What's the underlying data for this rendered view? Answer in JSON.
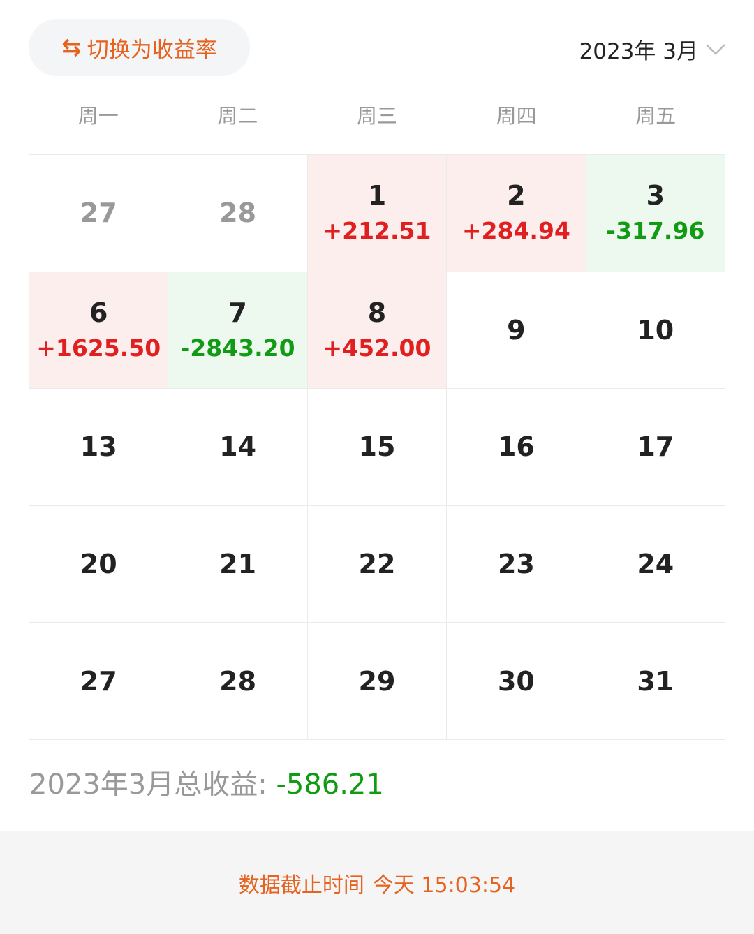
{
  "header": {
    "toggle_label": "切换为收益率",
    "month_label": "2023年 3月"
  },
  "weekdays": [
    "周一",
    "周二",
    "周三",
    "周四",
    "周五"
  ],
  "days": [
    {
      "day": "27",
      "value": "",
      "state": "other"
    },
    {
      "day": "28",
      "value": "",
      "state": "other"
    },
    {
      "day": "1",
      "value": "+212.51",
      "state": "up"
    },
    {
      "day": "2",
      "value": "+284.94",
      "state": "up"
    },
    {
      "day": "3",
      "value": "-317.96",
      "state": "down"
    },
    {
      "day": "6",
      "value": "+1625.50",
      "state": "up"
    },
    {
      "day": "7",
      "value": "-2843.20",
      "state": "down"
    },
    {
      "day": "8",
      "value": "+452.00",
      "state": "up"
    },
    {
      "day": "9",
      "value": "",
      "state": "none"
    },
    {
      "day": "10",
      "value": "",
      "state": "none"
    },
    {
      "day": "13",
      "value": "",
      "state": "none"
    },
    {
      "day": "14",
      "value": "",
      "state": "none"
    },
    {
      "day": "15",
      "value": "",
      "state": "none"
    },
    {
      "day": "16",
      "value": "",
      "state": "none"
    },
    {
      "day": "17",
      "value": "",
      "state": "none"
    },
    {
      "day": "20",
      "value": "",
      "state": "none"
    },
    {
      "day": "21",
      "value": "",
      "state": "none"
    },
    {
      "day": "22",
      "value": "",
      "state": "none"
    },
    {
      "day": "23",
      "value": "",
      "state": "none"
    },
    {
      "day": "24",
      "value": "",
      "state": "none"
    },
    {
      "day": "27",
      "value": "",
      "state": "none"
    },
    {
      "day": "28",
      "value": "",
      "state": "none"
    },
    {
      "day": "29",
      "value": "",
      "state": "none"
    },
    {
      "day": "30",
      "value": "",
      "state": "none"
    },
    {
      "day": "31",
      "value": "",
      "state": "none"
    }
  ],
  "summary": {
    "label": "2023年3月总收益: ",
    "total": "-586.21"
  },
  "footer": {
    "label": "数据截止时间",
    "timestamp": "今天 15:03:54"
  },
  "colors": {
    "accent": "#e5621f",
    "gain": "#e02020",
    "loss": "#119a13",
    "gain_bg": "#fdeeee",
    "loss_bg": "#edf8ee"
  },
  "icons": {
    "toggle": "swap-arrows-icon",
    "month_picker": "chevron-down-icon"
  }
}
